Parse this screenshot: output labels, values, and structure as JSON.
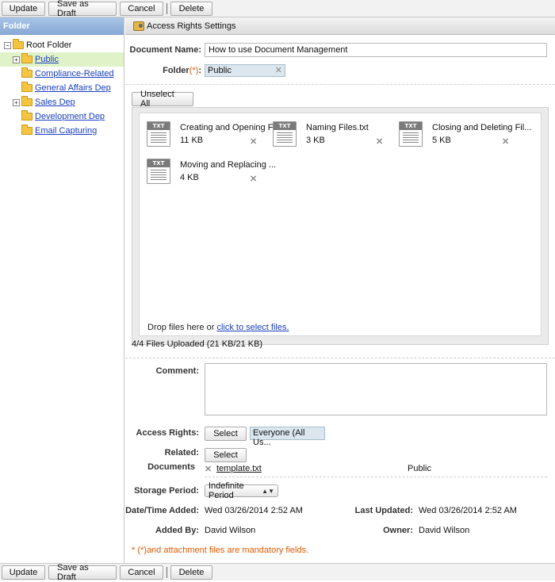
{
  "toolbar": {
    "update": "Update",
    "save_draft": "Save as Draft",
    "cancel": "Cancel",
    "delete": "Delete"
  },
  "sidebar": {
    "title": "Folder",
    "root": "Root Folder",
    "items": [
      {
        "label": "Public"
      },
      {
        "label": "Compliance-Related"
      },
      {
        "label": "General Affairs Dep"
      },
      {
        "label": "Sales Dep"
      },
      {
        "label": "Development Dep"
      },
      {
        "label": "Email Capturing"
      }
    ]
  },
  "tabs": {
    "access_rights": "Access Rights Settings"
  },
  "form": {
    "document_name_label": "Document Name:",
    "document_name_value": "How to use Document Management",
    "folder_label": "Folder",
    "folder_req": "(*)",
    "folder_colon": ":",
    "folder_value": "Public",
    "unselect_all": "Unselect All",
    "files": [
      {
        "name": "Creating and Opening F...",
        "size": "11 KB"
      },
      {
        "name": "Naming Files.txt",
        "size": "3 KB"
      },
      {
        "name": "Closing and Deleting Fil...",
        "size": "5 KB"
      },
      {
        "name": "Moving and Replacing ...",
        "size": "4 KB"
      }
    ],
    "file_icon_text": "TXT",
    "drop_text": "Drop files here or ",
    "drop_link": "click to select files.",
    "upload_status": "4/4 Files Uploaded (21 KB/21 KB)",
    "comment_label": "Comment:",
    "access_rights_label": "Access Rights:",
    "select_label": "Select",
    "access_rights_value": "Everyone (All Us...",
    "related_label": "Related:",
    "documents_label": "Documents",
    "related_doc_link": "template.txt",
    "related_doc_folder": "Public",
    "storage_period_label": "Storage Period:",
    "storage_period_value": "Indefinite Period",
    "date_added_label": "Date/Time Added:",
    "date_added_value": "Wed 03/26/2014 2:52 AM",
    "last_updated_label": "Last Updated:",
    "last_updated_value": "Wed 03/26/2014 2:52 AM",
    "added_by_label": "Added By:",
    "added_by_value": "David Wilson",
    "owner_label": "Owner:",
    "owner_value": "David Wilson",
    "mandatory_note": "* (*)and attachment files are mandatory fields."
  }
}
